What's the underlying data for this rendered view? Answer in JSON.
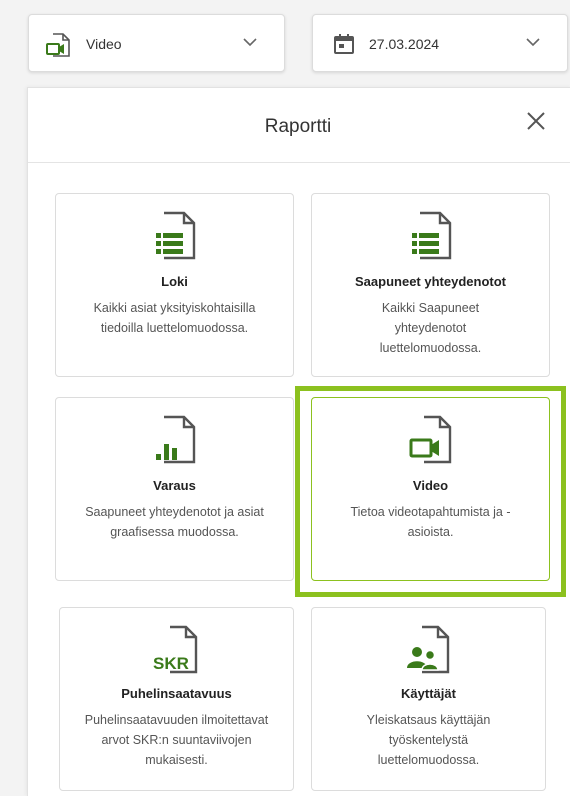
{
  "toolbar": {
    "type_select": {
      "value": "Video",
      "icon": "video-file-icon"
    },
    "date_select": {
      "value": "27.03.2024",
      "icon": "calendar-icon"
    }
  },
  "panel": {
    "title": "Raportti",
    "close_icon": "close-icon"
  },
  "accent_color": "#8cc11f",
  "icon_color": "#3a7a1a",
  "cards": [
    {
      "title": "Loki",
      "description": "Kaikki asiat yksityiskohtaisilla tiedoilla luettelomuodossa.",
      "icon": "list-document-icon",
      "selected": false
    },
    {
      "title": "Saapuneet yhteydenotot",
      "description": "Kaikki Saapuneet yhteydenotot luettelomuodossa.",
      "icon": "list-document-icon",
      "selected": false
    },
    {
      "title": "Varaus",
      "description": "Saapuneet yhteydenotot ja asiat graafisessa muodossa.",
      "icon": "bar-chart-document-icon",
      "selected": false
    },
    {
      "title": "Video",
      "description": "Tietoa videotapahtumista ja -asioista.",
      "icon": "video-document-icon",
      "selected": true
    },
    {
      "title": "Puhelinsaatavuus",
      "description": "Puhelinsaatavuuden ilmoitettavat arvot SKR:n suuntaviivojen mukaisesti.",
      "icon": "skr-document-icon",
      "icon_text": "SKR",
      "selected": false
    },
    {
      "title": "Käyttäjät",
      "description": "Yleiskatsaus käyttäjän työskentelystä luettelomuodossa.",
      "icon": "users-document-icon",
      "selected": false
    }
  ]
}
